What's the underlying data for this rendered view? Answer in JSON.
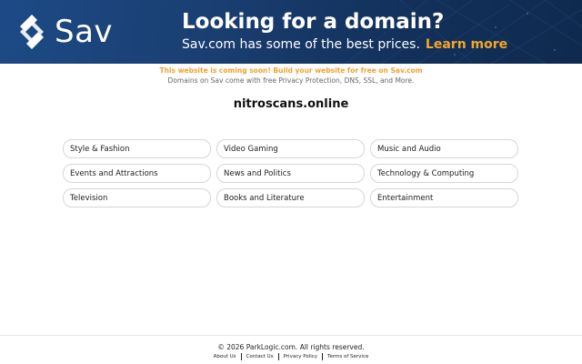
{
  "banner": {
    "logo_text": "Sav",
    "headline": "Looking for a domain?",
    "subline": "Sav.com has some of the best prices.",
    "learn_more": "Learn more",
    "accent_color": "#f5a623",
    "background_color": "#1a3f72"
  },
  "notice": {
    "coming_soon": "This website is coming soon! Build your website for free on Sav.com",
    "features": "Domains on Sav come with free Privacy Protection, DNS, SSL, and More."
  },
  "domain": "nitroscans.online",
  "categories": [
    "Style & Fashion",
    "Video Gaming",
    "Music and Audio",
    "Events and Attractions",
    "News and Politics",
    "Technology & Computing",
    "Television",
    "Books and Literature",
    "Entertainment"
  ],
  "footer": {
    "copyright": "© 2026 ParkLogic.com. All rights reserved.",
    "links": [
      "About Us",
      "Contact Us",
      "Privacy Policy",
      "Terms of Service"
    ]
  }
}
